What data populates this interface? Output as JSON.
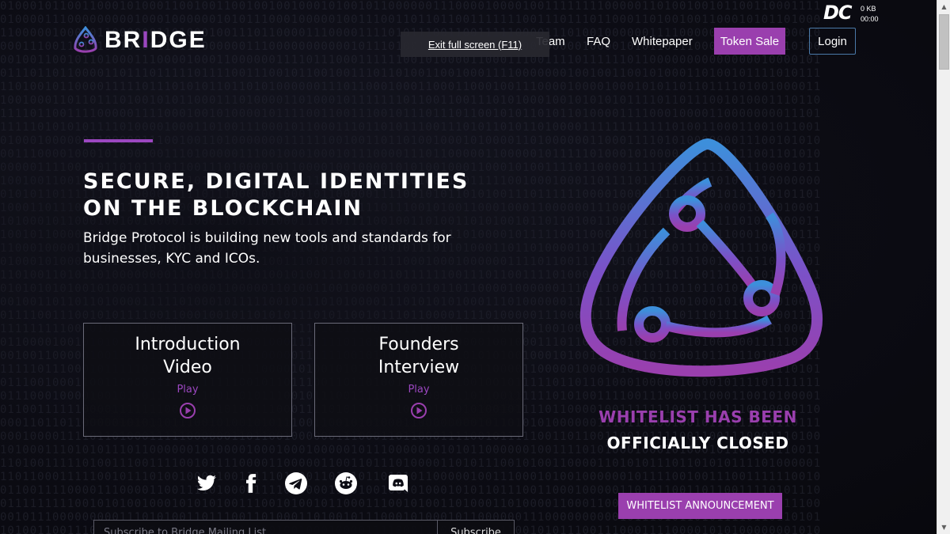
{
  "brand": {
    "name_part1": "BR",
    "name_accent": "I",
    "name_part2": "DGE"
  },
  "browser": {
    "fullscreen_banner": "Exit full screen (F11)"
  },
  "overlay": {
    "dc_logo": "DC",
    "stat_size": "0 KB",
    "stat_time": "00:00"
  },
  "nav": {
    "items": [
      "Team",
      "FAQ",
      "Whitepaper"
    ],
    "token_sale": "Token Sale",
    "login": "Login"
  },
  "hero": {
    "title_line1": "SECURE, DIGITAL IDENTITIES",
    "title_line2": "ON THE BLOCKCHAIN",
    "subtitle_line1": "Bridge Protocol is building new tools and standards for",
    "subtitle_line2": "businesses, KYC and ICOs."
  },
  "cards": [
    {
      "title_line1": "Introduction",
      "title_line2": "Video",
      "play": "Play"
    },
    {
      "title_line1": "Founders",
      "title_line2": "Interview",
      "play": "Play"
    }
  ],
  "social": [
    "twitter-icon",
    "facebook-icon",
    "telegram-icon",
    "reddit-icon",
    "discord-icon"
  ],
  "subscribe": {
    "placeholder": "Subscribe to Bridge Mailing List",
    "button": "Subscribe"
  },
  "whitelist": {
    "line1": "WHITELIST HAS BEEN",
    "line2": "OFFICIALLY CLOSED",
    "button": "WHITELIST ANNOUNCEMENT"
  },
  "colors": {
    "accent": "#9a3fae",
    "blue": "#3d8fdb",
    "background": "#0c0c14"
  }
}
